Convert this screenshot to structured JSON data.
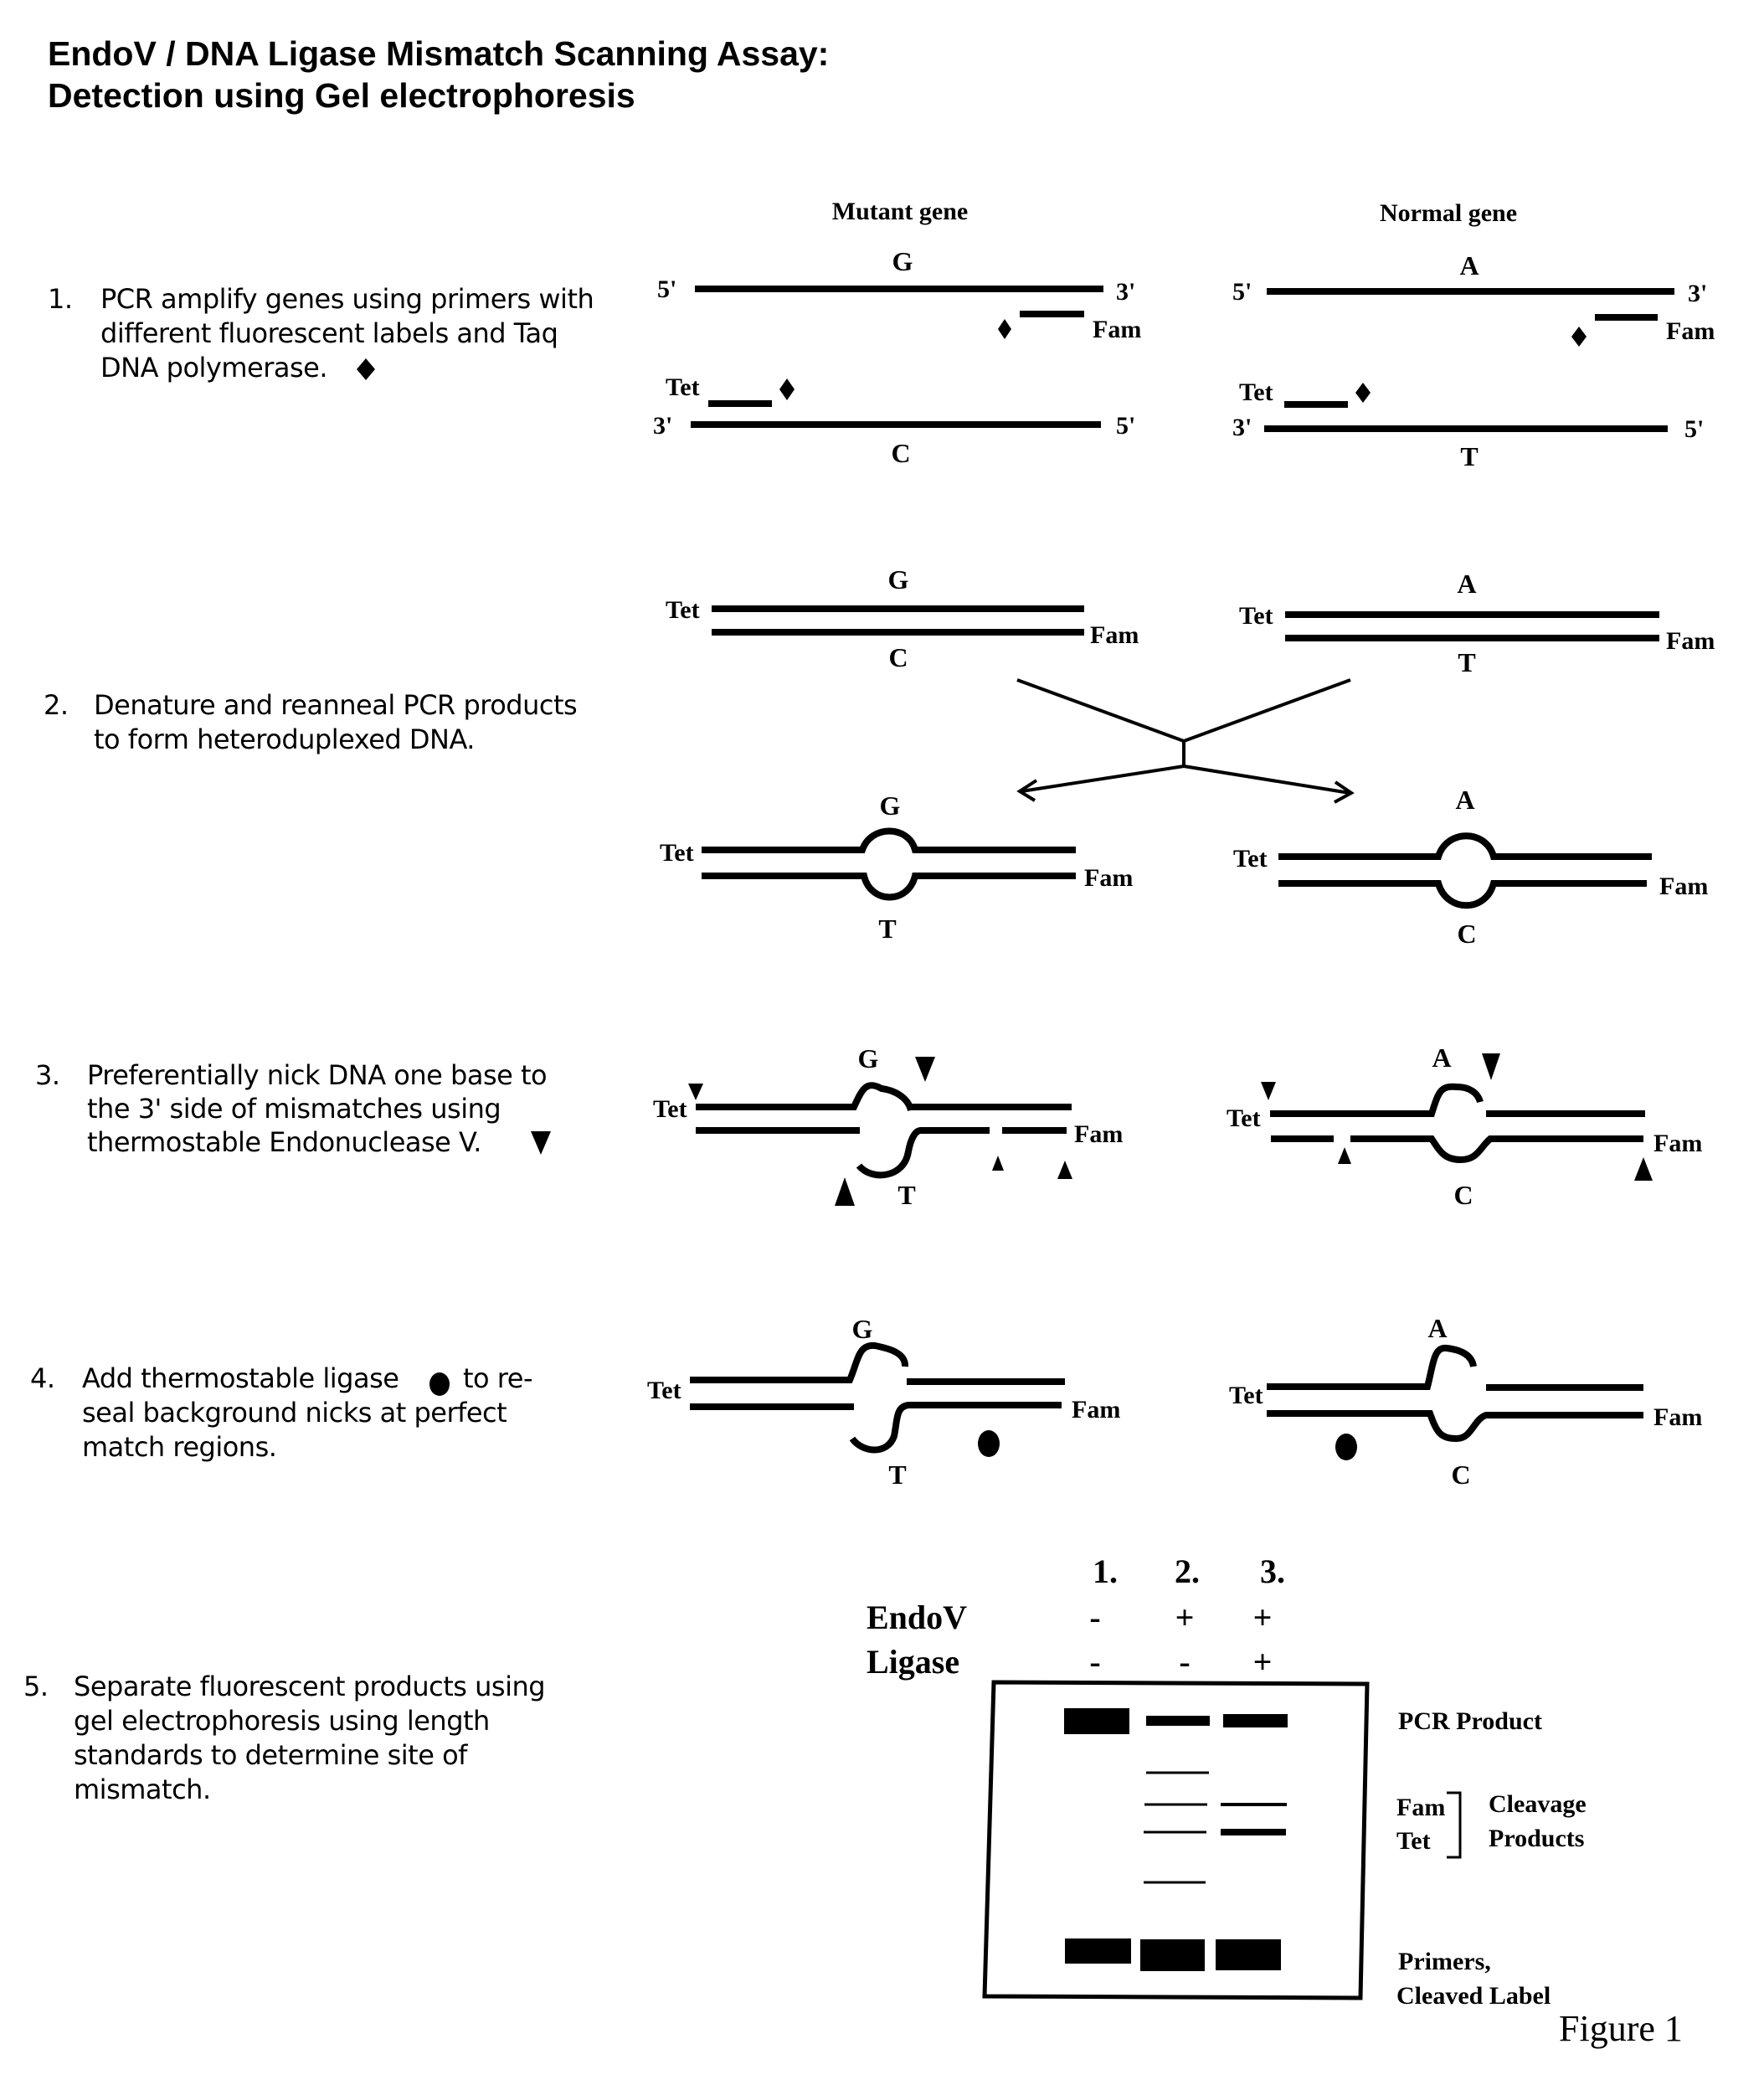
{
  "title": {
    "line1": "EndoV / DNA Ligase Mismatch Scanning Assay:",
    "line2": "Detection using Gel electrophoresis"
  },
  "columns": {
    "mutant": "Mutant gene",
    "normal": "Normal gene"
  },
  "steps": [
    {
      "number": "1.",
      "lines": [
        "PCR amplify genes using primers with",
        "different fluorescent labels and Taq",
        "DNA polymerase."
      ],
      "symbol": "diamond"
    },
    {
      "number": "2.",
      "lines": [
        "Denature and reanneal PCR products",
        "to form heteroduplexed DNA."
      ]
    },
    {
      "number": "3.",
      "lines": [
        "Preferentially nick DNA one base to",
        "the 3' side of mismatches using",
        "thermostable Endonuclease V."
      ],
      "symbol": "down-triangle"
    },
    {
      "number": "4.",
      "lines": [
        "Add thermostable ligase",
        "seal background nicks at perfect",
        "match regions."
      ],
      "line1_suffix": "to re-",
      "symbol": "dot"
    },
    {
      "number": "5.",
      "lines": [
        "Separate fluorescent products using",
        "gel electrophoresis using length",
        "standards to determine site of",
        "mismatch."
      ]
    }
  ],
  "labels": {
    "five_prime": "5'",
    "three_prime": "3'",
    "tet": "Tet",
    "fam": "Fam"
  },
  "bases": {
    "mutant_top": "G",
    "mutant_bottom": "C",
    "normal_top": "A",
    "normal_bottom": "T",
    "mutant_hetero_bottom": "T",
    "normal_hetero_bottom": "C"
  },
  "gel": {
    "lanes": [
      "1.",
      "2.",
      "3."
    ],
    "rows": [
      {
        "label": "EndoV",
        "values": [
          "-",
          "+",
          "+"
        ]
      },
      {
        "label": "Ligase",
        "values": [
          "-",
          "-",
          "+"
        ]
      }
    ],
    "band_labels": {
      "pcr_product": "PCR Product",
      "fam": "Fam",
      "tet": "Tet",
      "cleavage_line1": "Cleavage",
      "cleavage_line2": "Products",
      "primers_line1": "Primers,",
      "primers_line2": "Cleaved Label"
    }
  },
  "figure_label": "Figure 1"
}
